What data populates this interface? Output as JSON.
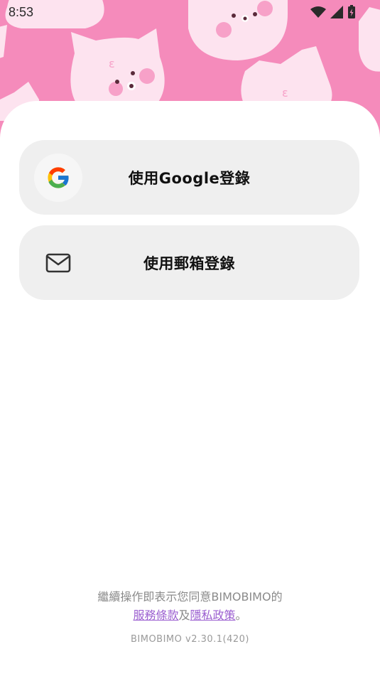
{
  "status_bar": {
    "time": "8:53",
    "icons": [
      "wifi-icon",
      "cellular-signal-icon",
      "battery-charging-icon"
    ]
  },
  "banner": {
    "background_color": "#f58bbb",
    "decoration": "pink-cat-characters"
  },
  "login": {
    "google_label": "使用Google登錄",
    "email_label": "使用郵箱登錄",
    "button_background": "#efefef"
  },
  "footer": {
    "terms_text": "繼續操作即表示您同意BIMOBIMO的",
    "terms_of_service": "服務條款",
    "and": "及",
    "privacy_policy": "隱私政策",
    "period": "。",
    "version": "BIMOBIMO v2.30.1(420)",
    "link_color": "#9b5fd0"
  }
}
